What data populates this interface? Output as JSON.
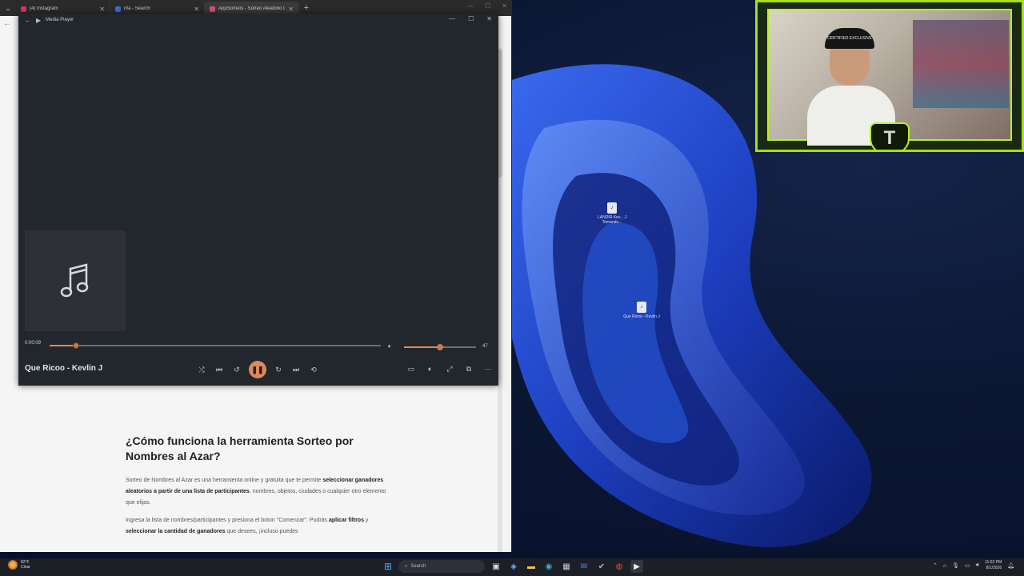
{
  "browser": {
    "tabs": [
      {
        "title": "(4) Instagram",
        "color": "#e1306c"
      },
      {
        "title": "rifa - Search",
        "color": "#3a6fd8"
      },
      {
        "title": "AppSorteos - Sorteo Aleatorio O...",
        "color": "#d4547a",
        "active": true
      }
    ],
    "new_tab_label": "+"
  },
  "player": {
    "title": "Media Player",
    "elapsed": "0:00:09",
    "song_title": "Que Ricoo - Kevlin J",
    "progress": 0.08,
    "volume": 47,
    "volume_fraction": 0.5,
    "volume_label": "47",
    "accent_color": "#d98a5d"
  },
  "article": {
    "heading": "¿Cómo funciona la herramienta Sorteo por Nombres al Azar?",
    "p1_a": "Sorteo de Nombres al Azar es una herramienta online y gratuita que te permite ",
    "p1_bold": "seleccionar ganadores aleatorios a partir de una lista de participantes",
    "p1_b": ", nombres, objetos, ciudades o cualquier otro elemento que elijas.",
    "p2_a": "Ingresa la lista de nombres/participantes y presiona el boton \"Comenzar\". Podrás ",
    "p2_bold1": "aplicar filtros",
    "p2_b": " y ",
    "p2_bold2": "seleccionar la cantidad de ganadores",
    "p2_c": " que desees, ¡incluso puedes"
  },
  "desktop": {
    "icons": [
      {
        "label": "LANDIR Kev... J Tomando..."
      },
      {
        "label": "Que Ricoo - Kevlin J"
      }
    ]
  },
  "webcam": {
    "cap_text": "CERTIFIED EXCLUSIVE",
    "logo_letter": "T"
  },
  "taskbar": {
    "weather_temp": "82°F",
    "weather_cond": "Clear",
    "search_label": "Search",
    "time": "11:02 PM",
    "date": "8/1/2026"
  }
}
